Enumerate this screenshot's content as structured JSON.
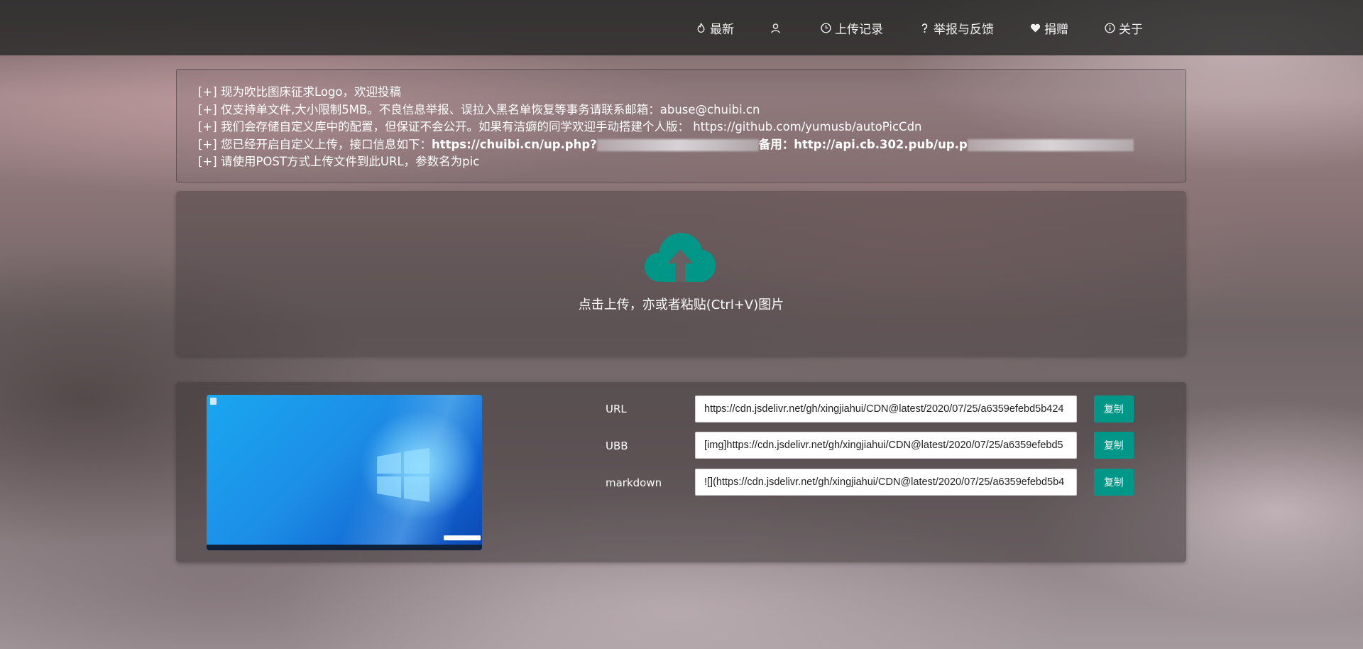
{
  "nav": {
    "items": [
      {
        "label": "最新",
        "icon": "fire-icon"
      },
      {
        "label": "",
        "icon": "user-icon"
      },
      {
        "label": "上传记录",
        "icon": "clock-icon"
      },
      {
        "label": "举报与反馈",
        "icon": "question-icon"
      },
      {
        "label": "捐赠",
        "icon": "heart-icon"
      },
      {
        "label": "关于",
        "icon": "info-icon"
      }
    ]
  },
  "notice": {
    "line1": "[+] 现为吹比图床征求Logo，欢迎投稿",
    "line2": "[+] 仅支持单文件,大小限制5MB。不良信息举报、误拉入黑名单恢复等事务请联系邮箱：abuse@chuibi.cn",
    "line3": "[+] 我们会存储自定义库中的配置，但保证不会公开。如果有洁癖的同学欢迎手动搭建个人版： https://github.com/yumusb/autoPicCdn",
    "line4_prefix": "[+] 您已经开启自定义上传，接口信息如下：",
    "line4_url1": "https://chuibi.cn/up.php?",
    "line4_backup_label": "备用：",
    "line4_url2": "http://api.cb.302.pub/up.p",
    "line5": "[+] 请使用POST方式上传文件到此URL，参数名为pic"
  },
  "upload": {
    "icon": "cloud-upload-icon",
    "text": "点击上传，亦或者粘贴(Ctrl+V)图片"
  },
  "result": {
    "rows": [
      {
        "label": "URL",
        "value": "https://cdn.jsdelivr.net/gh/xingjiahui/CDN@latest/2020/07/25/a6359efebd5b424",
        "button": "复制"
      },
      {
        "label": "UBB",
        "value": "[img]https://cdn.jsdelivr.net/gh/xingjiahui/CDN@latest/2020/07/25/a6359efebd5",
        "button": "复制"
      },
      {
        "label": "markdown",
        "value": "![](https://cdn.jsdelivr.net/gh/xingjiahui/CDN@latest/2020/07/25/a6359efebd5b4",
        "button": "复制"
      }
    ]
  },
  "colors": {
    "accent": "#009688",
    "nav_bg": "#2a2a2a"
  }
}
